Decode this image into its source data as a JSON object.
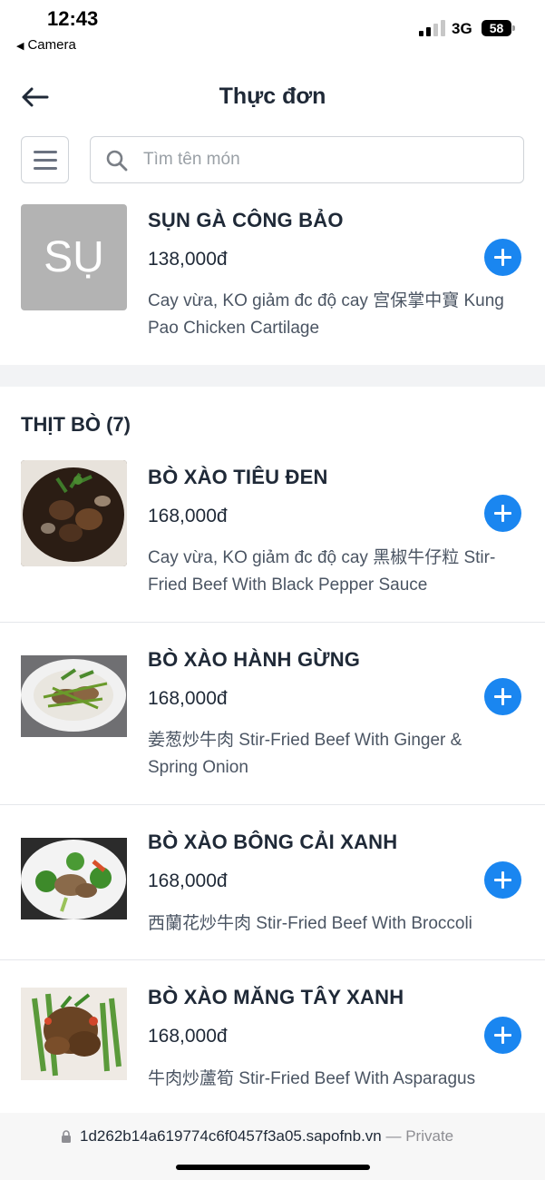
{
  "status": {
    "time": "12:43",
    "back_app": "Camera",
    "network": "3G",
    "battery": "58"
  },
  "header": {
    "title": "Thực đơn"
  },
  "search": {
    "placeholder": "Tìm tên món"
  },
  "top_item": {
    "placeholder_text": "SỤ",
    "name": "SỤN GÀ CÔNG BẢO",
    "price": "138,000đ",
    "description": "Cay vừa, KO giảm đc độ cay 宫保掌中寶 Kung Pao Chicken Cartilage"
  },
  "category": {
    "title": "THỊT BÒ (7)",
    "items": [
      {
        "name": "BÒ XÀO TIÊU ĐEN",
        "price": "168,000đ",
        "description": "Cay vừa, KO giảm đc độ cay 黑椒牛仔粒 Stir-Fried Beef With Black Pepper Sauce"
      },
      {
        "name": "BÒ XÀO HÀNH GỪNG",
        "price": "168,000đ",
        "description": "姜葱炒牛肉 Stir-Fried Beef With Ginger & Spring Onion"
      },
      {
        "name": "BÒ XÀO BÔNG CẢI XANH",
        "price": "168,000đ",
        "description": "西蘭花炒牛肉 Stir-Fried Beef With Broccoli"
      },
      {
        "name": "BÒ XÀO MĂNG TÂY XANH",
        "price": "168,000đ",
        "description": "牛肉炒蘆筍 Stir-Fried Beef With Asparagus"
      }
    ]
  },
  "url_bar": {
    "url": "1d262b14a619774c6f0457f3a05.sapofnb.vn",
    "suffix": " — Private"
  },
  "colors": {
    "accent": "#1a86f0",
    "placeholder_thumb": "#b3b3b3",
    "section_gap": "#f2f3f5"
  },
  "icons": [
    "back-arrow-icon",
    "hamburger-menu-icon",
    "search-icon",
    "plus-icon",
    "lock-icon"
  ]
}
